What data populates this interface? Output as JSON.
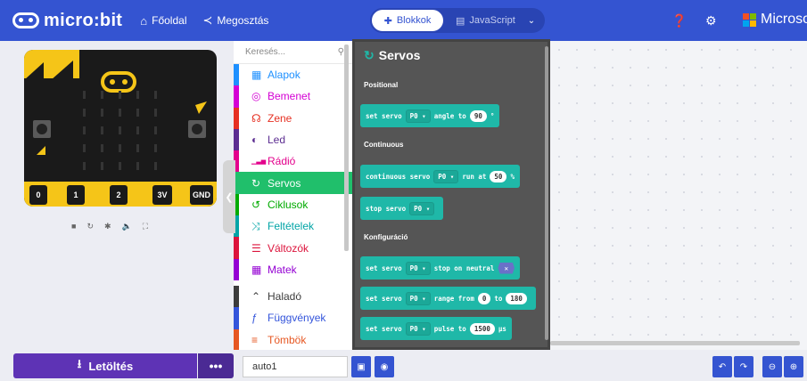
{
  "header": {
    "logo_text": "micro:bit",
    "home_label": "Főoldal",
    "share_label": "Megosztás",
    "blocks_label": "Blokkok",
    "js_label": "JavaScript",
    "ms_text": "Microsoft",
    "ms_colors": [
      "#f25022",
      "#7fba00",
      "#00a4ef",
      "#ffb900"
    ]
  },
  "simulator": {
    "btn_a": "A",
    "btn_b": "B",
    "pins": [
      "0",
      "1",
      "2",
      "3V",
      "GND"
    ]
  },
  "toolbox": {
    "search_placeholder": "Keresés...",
    "categories": [
      {
        "label": "Alapok",
        "color": "#1e90ff",
        "icon": "grid-icon"
      },
      {
        "label": "Bemenet",
        "color": "#d400d4",
        "icon": "target-icon"
      },
      {
        "label": "Zene",
        "color": "#e63022",
        "icon": "headphones-icon"
      },
      {
        "label": "Led",
        "color": "#5c2d91",
        "icon": "toggle-icon"
      },
      {
        "label": "Rádió",
        "color": "#e3008c",
        "icon": "signal-icon"
      },
      {
        "label": "Servos",
        "color": "#20bf6b",
        "icon": "refresh-icon"
      },
      {
        "label": "Ciklusok",
        "color": "#00aa00",
        "icon": "loop-icon"
      },
      {
        "label": "Feltételek",
        "color": "#00a4a6",
        "icon": "shuffle-icon"
      },
      {
        "label": "Változók",
        "color": "#dc143c",
        "icon": "lines-icon"
      },
      {
        "label": "Matek",
        "color": "#9400d3",
        "icon": "calculator-icon"
      },
      {
        "label": "Haladó",
        "color": "#3c3c3c",
        "icon": "chevron-up-icon"
      },
      {
        "label": "Függvények",
        "color": "#3455db",
        "icon": "function-icon"
      },
      {
        "label": "Tömbök",
        "color": "#e65722",
        "icon": "list-icon"
      }
    ]
  },
  "flyout": {
    "title": "Servos",
    "section_positional": "Positional",
    "section_continuous": "Continuous",
    "section_config": "Konfiguráció",
    "b1": {
      "t1": "set servo",
      "pin": "P0 ▾",
      "t2": "angle to",
      "val": "90",
      "suffix": "°"
    },
    "b2": {
      "t1": "continuous servo",
      "pin": "P0 ▾",
      "t2": "run at",
      "val": "50",
      "suffix": "%"
    },
    "b3": {
      "t1": "stop servo",
      "pin": "P0 ▾"
    },
    "b4": {
      "t1": "set servo",
      "pin": "P0 ▾",
      "t2": "stop on neutral",
      "toggle": "✕"
    },
    "b5": {
      "t1": "set servo",
      "pin": "P0 ▾",
      "t2": "range from",
      "val": "0",
      "t3": "to",
      "val2": "180"
    },
    "b6": {
      "t1": "set servo",
      "pin": "P0 ▾",
      "t2": "pulse to",
      "val": "1500",
      "suffix": "μs"
    }
  },
  "bottom": {
    "download_label": "Letöltés",
    "more_label": "•••",
    "project_name": "auto1"
  }
}
